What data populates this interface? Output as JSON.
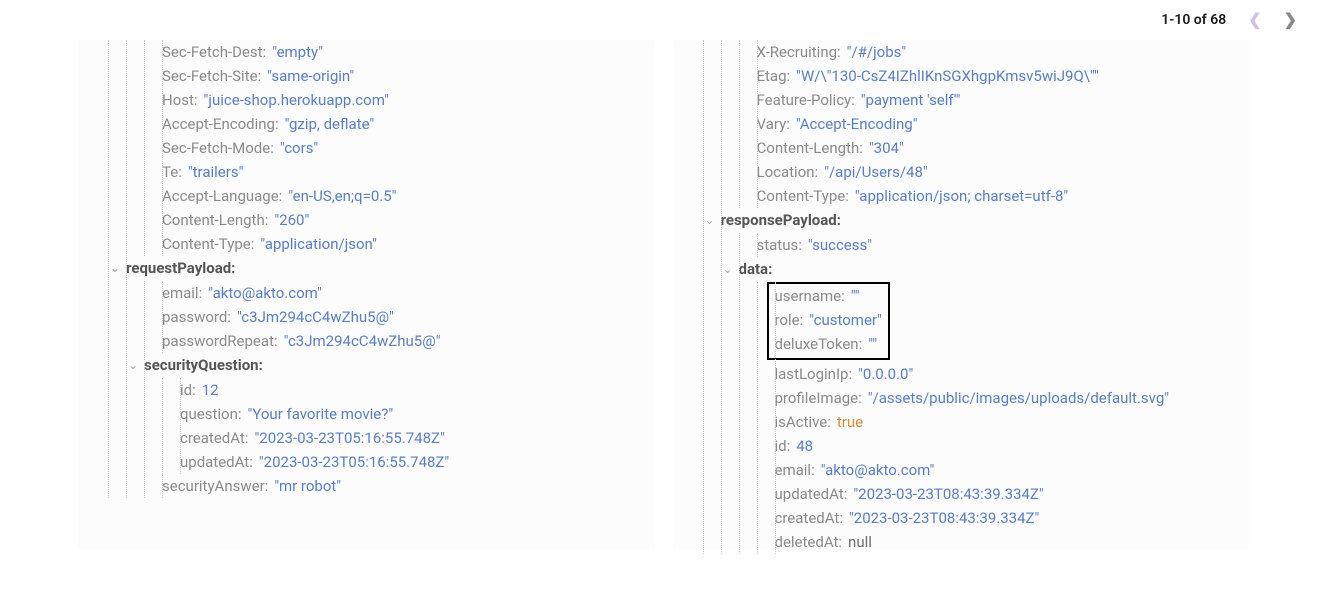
{
  "pagination": {
    "label": "1-10 of 68"
  },
  "left": {
    "secFetchDest": "\"empty\"",
    "secFetchSite": "\"same-origin\"",
    "host": "\"juice-shop.herokuapp.com\"",
    "acceptEncoding": "\"gzip, deflate\"",
    "secFetchMode": "\"cors\"",
    "te": "\"trailers\"",
    "acceptLanguage": "\"en-US,en;q=0.5\"",
    "contentLength": "\"260\"",
    "contentType": "\"application/json\"",
    "requestPayload": {
      "email": "\"akto@akto.com\"",
      "password": "\"c3Jm294cC4wZhu5@\"",
      "passwordRepeat": "\"c3Jm294cC4wZhu5@\"",
      "securityQuestion": {
        "id": "12",
        "question": "\"Your favorite movie?\"",
        "createdAt": "\"2023-03-23T05:16:55.748Z\"",
        "updatedAt": "\"2023-03-23T05:16:55.748Z\""
      },
      "securityAnswer": "\"mr robot\""
    }
  },
  "right": {
    "xRecruiting": "\"/#/jobs\"",
    "etag": "\"W/\\\"130-CsZ4IZhlIKnSGXhgpKmsv5wiJ9Q\\\"\"",
    "featurePolicy": "\"payment 'self'\"",
    "vary": "\"Accept-Encoding\"",
    "contentLength": "\"304\"",
    "location": "\"/api/Users/48\"",
    "contentType": "\"application/json; charset=utf-8\"",
    "responsePayload": {
      "status": "\"success\"",
      "data": {
        "username": "\"\"",
        "role": "\"customer\"",
        "deluxeToken": "\"\"",
        "lastLoginIp": "\"0.0.0.0\"",
        "profileImage": "\"/assets/public/images/uploads/default.svg\"",
        "isActive": "true",
        "id": "48",
        "email": "\"akto@akto.com\"",
        "updatedAt": "\"2023-03-23T08:43:39.334Z\"",
        "createdAt": "\"2023-03-23T08:43:39.334Z\"",
        "deletedAt": "null"
      }
    }
  }
}
